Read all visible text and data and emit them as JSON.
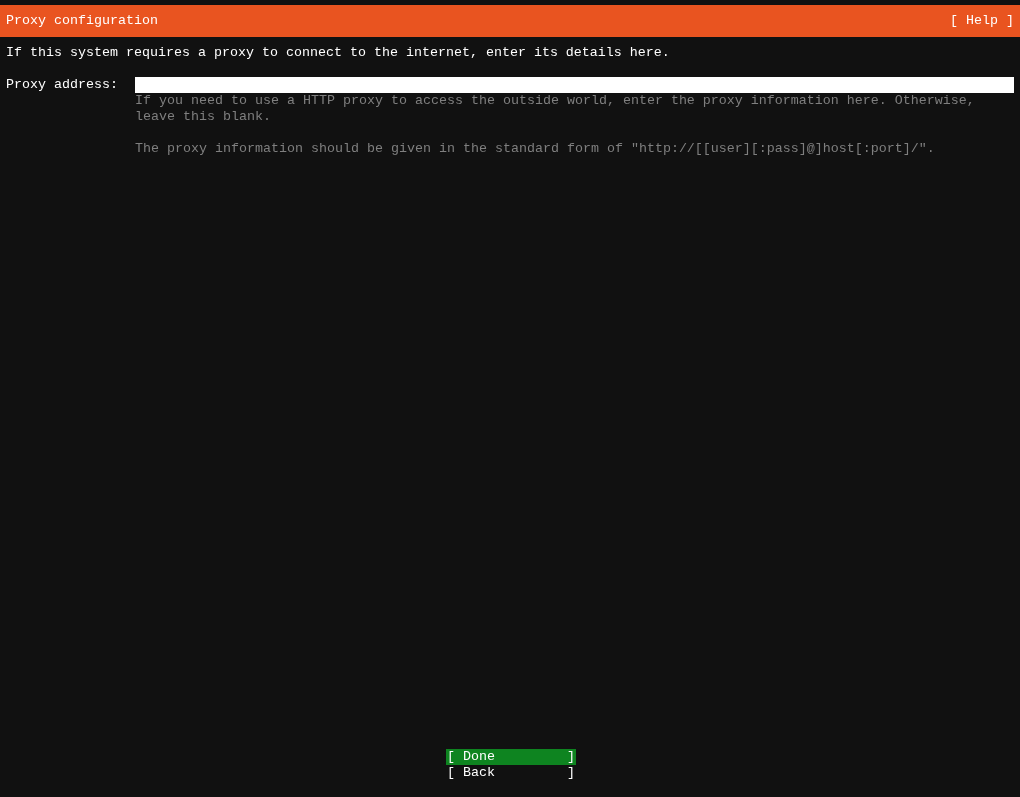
{
  "header": {
    "title": "Proxy configuration",
    "help": "[ Help ]"
  },
  "intro": "If this system requires a proxy to connect to the internet, enter its details here.",
  "proxy_field": {
    "label": "Proxy address:"
  },
  "hints": [
    "If you need to use a HTTP proxy to access the outside world, enter the proxy information here. Otherwise, leave this blank.",
    "The proxy information should be given in the standard form of \"http://[[user][:pass]@]host[:port]/\"."
  ],
  "buttons": [
    {
      "label": "[ Done         ]",
      "selected": true
    },
    {
      "label": "[ Back         ]",
      "selected": false
    }
  ]
}
